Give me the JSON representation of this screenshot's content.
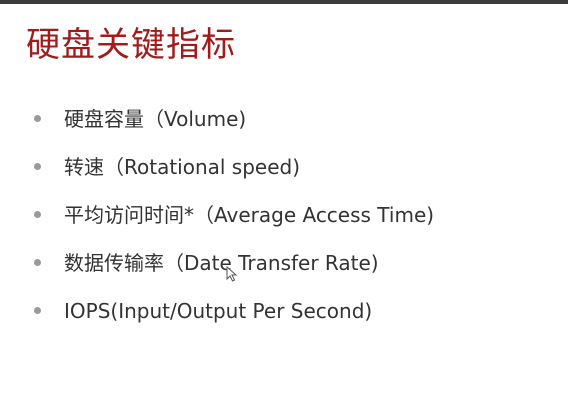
{
  "slide": {
    "title": "硬盘关键指标",
    "bullets": [
      {
        "text": "硬盘容量（Volume)"
      },
      {
        "text": "转速（Rotational speed)"
      },
      {
        "text": "平均访问时间*（Average Access Time)"
      },
      {
        "text": "数据传输率（Date Transfer Rate)"
      },
      {
        "text": "IOPS(Input/Output Per Second)"
      }
    ]
  },
  "colors": {
    "title": "#a01c1c",
    "text": "#333333",
    "bullet": "#9a9a9a",
    "top_bar": "#3b3b3b"
  },
  "icons": {
    "bullet": "bullet-dot-icon",
    "cursor": "mouse-cursor-icon"
  }
}
